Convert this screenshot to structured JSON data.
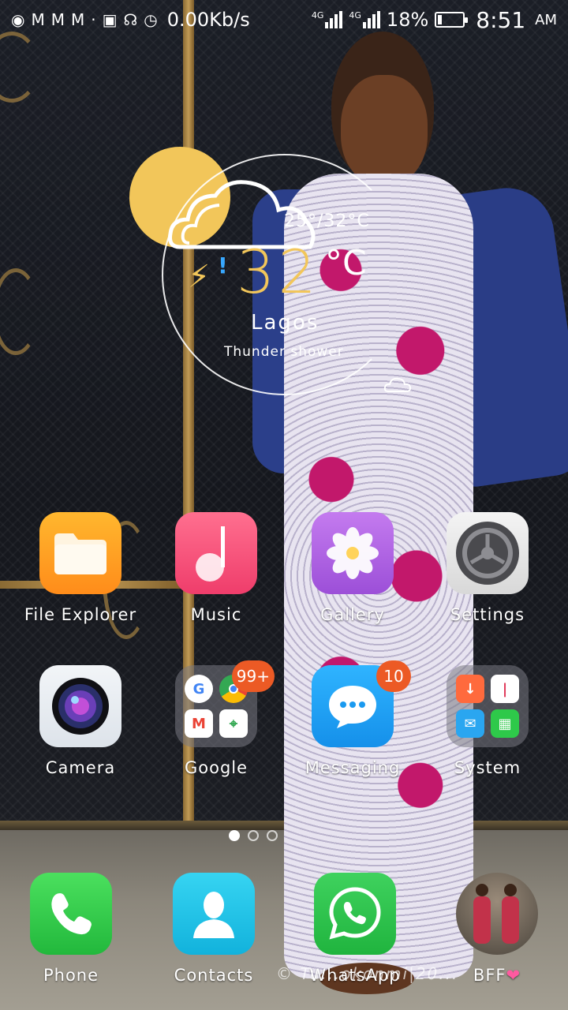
{
  "status_bar": {
    "speed": "0.00Kb/s",
    "network_1": "4G",
    "network_2": "4G",
    "battery_percent_text": "18%",
    "battery_level": 0.18,
    "time": "8:51",
    "ampm": "AM",
    "icons": [
      "location-icon",
      "gmail-icon",
      "gmail-icon",
      "gmail-icon",
      "dot-icon",
      "sim-card-icon",
      "headset-icon",
      "alarm-icon"
    ]
  },
  "weather": {
    "range": "25°/32°C",
    "temperature": "32",
    "unit": "°C",
    "city": "Lagos",
    "description": "Thunder shower",
    "icon": "thunder-shower-icon",
    "colors": {
      "sun": "#f2c65a",
      "accent": "#38a8ff"
    }
  },
  "apps": [
    {
      "label": "File Explorer",
      "icon": "folder-icon",
      "color": "#ff9f1a"
    },
    {
      "label": "Music",
      "icon": "music-note-icon",
      "color": "#f2507a"
    },
    {
      "label": "Gallery",
      "icon": "flower-icon",
      "color": "#b062e0"
    },
    {
      "label": "Settings",
      "icon": "gear-icon",
      "color": "#eeeeee"
    },
    {
      "label": "Camera",
      "icon": "camera-lens-icon",
      "color": "#e9eef3"
    },
    {
      "label": "Google",
      "icon": "google-folder-icon",
      "badge": "99+"
    },
    {
      "label": "Messaging",
      "icon": "chat-bubble-icon",
      "color": "#1ea4f5",
      "badge": "10"
    },
    {
      "label": "System",
      "icon": "system-folder-icon"
    }
  ],
  "dock": [
    {
      "label": "Phone",
      "icon": "phone-icon",
      "color": "#32c84a"
    },
    {
      "label": "Contacts",
      "icon": "contact-person-icon",
      "color": "#1ec0e6"
    },
    {
      "label": "WhatsApp",
      "icon": "whatsapp-icon",
      "color": "#2fbd4d"
    },
    {
      "label": "BFF",
      "icon": "photo-avatar-icon",
      "heart": "❤"
    }
  ],
  "page_indicator": {
    "pages": 3,
    "current": 1
  },
  "wallpaper_watermark": "© Tu...okonmi|20..."
}
